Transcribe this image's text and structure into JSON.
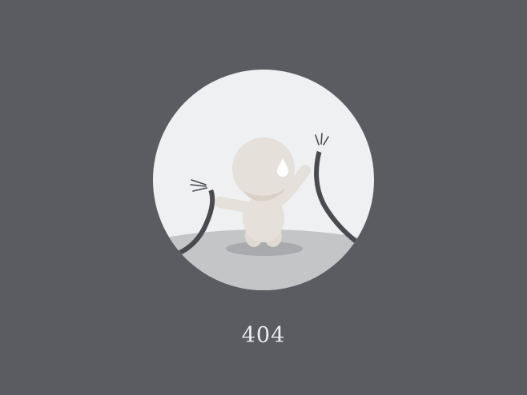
{
  "error": {
    "code": "404"
  },
  "illustration": {
    "icon": "unplugged-cable-character-icon",
    "colors": {
      "background": "#5b5c62",
      "circle": "#eef0f2",
      "ground": "#c4c5c7",
      "character": "#e5e0d9",
      "cable": "#4a4b50",
      "tear": "#ffffff"
    }
  }
}
